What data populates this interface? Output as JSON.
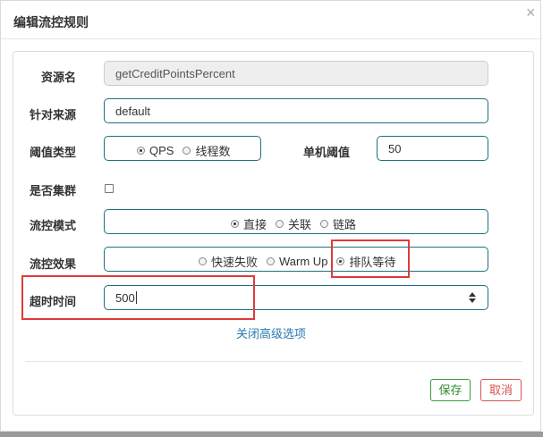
{
  "dialog": {
    "title": "编辑流控规则",
    "close_symbol": "×"
  },
  "form": {
    "resource": {
      "label": "资源名",
      "value": "getCreditPointsPercent"
    },
    "limit_app": {
      "label": "针对来源",
      "value": "default"
    },
    "threshold_type": {
      "label": "阈值类型",
      "options": [
        "QPS",
        "线程数"
      ],
      "selected": "QPS"
    },
    "single_threshold": {
      "label": "单机阈值",
      "value": "50"
    },
    "cluster": {
      "label": "是否集群",
      "checked": false
    },
    "flow_mode": {
      "label": "流控模式",
      "options": [
        "直接",
        "关联",
        "链路"
      ],
      "selected": "直接"
    },
    "flow_effect": {
      "label": "流控效果",
      "options": [
        "快速失败",
        "Warm Up",
        "排队等待"
      ],
      "selected": "排队等待"
    },
    "timeout": {
      "label": "超时时间",
      "value": "500"
    }
  },
  "advanced_link": "关闭高级选项",
  "buttons": {
    "save": "保存",
    "cancel": "取消"
  },
  "colors": {
    "input_border": "#1f6f84",
    "save": "#3c9a3c",
    "cancel": "#d9534f",
    "annotation": "#e03a3a",
    "link": "#2a7ab0"
  }
}
